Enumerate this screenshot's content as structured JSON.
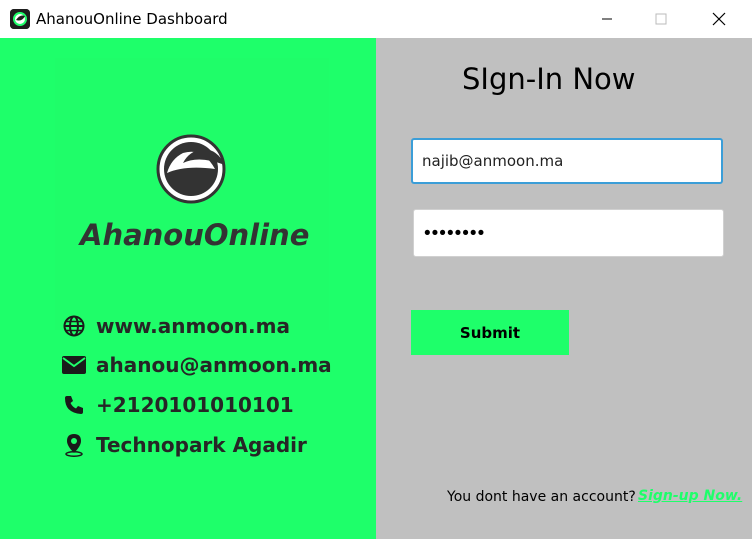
{
  "window": {
    "title": "AhanouOnline Dashboard"
  },
  "brand": {
    "logo_text": "AhanouOnline",
    "accent_color": "#1eff6a",
    "panel_color": "#c0c0c0"
  },
  "contacts": [
    {
      "icon": "globe-icon",
      "text": "www.anmoon.ma"
    },
    {
      "icon": "envelope-icon",
      "text": "ahanou@anmoon.ma"
    },
    {
      "icon": "phone-icon",
      "text": "+2120101010101"
    },
    {
      "icon": "location-pin-icon",
      "text": "Technopark Agadir"
    }
  ],
  "signin": {
    "title": "SIgn-In Now",
    "email_value": "najib@anmoon.ma",
    "password_mask": "••••••••",
    "submit_label": "Submit",
    "no_account_text": "You dont have an account?",
    "signup_link": "Sign-up Now."
  }
}
